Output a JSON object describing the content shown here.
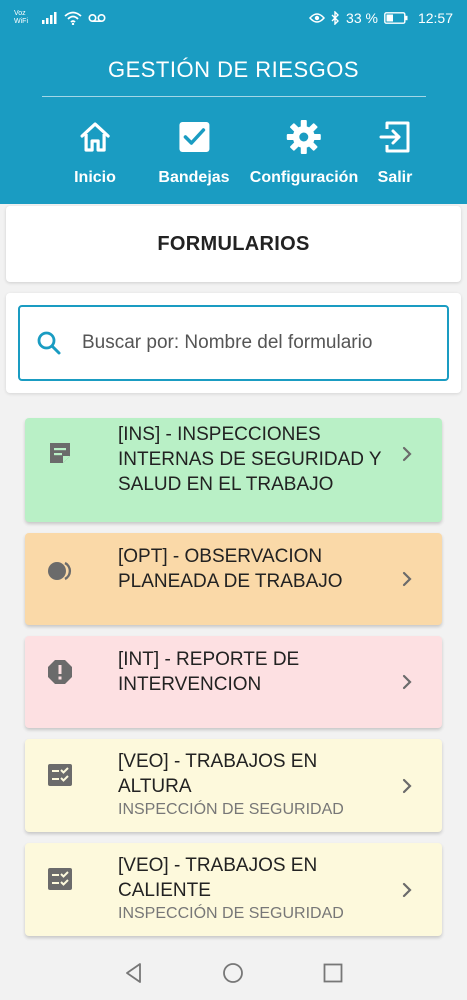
{
  "status_bar": {
    "carrier_line1": "Voz",
    "carrier_line2": "WiFi",
    "battery": "33 %",
    "time": "12:57"
  },
  "header": {
    "title": "GESTIÓN DE RIESGOS",
    "nav": [
      {
        "label": "Inicio",
        "icon": "home-icon"
      },
      {
        "label": "Bandejas",
        "icon": "checkbox-icon"
      },
      {
        "label": "Configuración",
        "icon": "gear-icon"
      },
      {
        "label": "Salir",
        "icon": "logout-icon"
      }
    ]
  },
  "section": {
    "title": "FORMULARIOS"
  },
  "search": {
    "placeholder": "Buscar por: Nombre del formulario"
  },
  "forms": [
    {
      "title": "[INS] - INSPECCIONES INTERNAS DE SEGURIDAD Y SALUD EN EL TRABAJO",
      "subtitle": "",
      "icon": "note-icon",
      "color": "#b9f0c6"
    },
    {
      "title": "[OPT] - OBSERVACION PLANEADA DE TRABAJO",
      "subtitle": "",
      "icon": "toggle-icon",
      "color": "#fad9a8"
    },
    {
      "title": "[INT] - REPORTE DE INTERVENCION",
      "subtitle": "",
      "icon": "alert-octagon-icon",
      "color": "#fde0e2"
    },
    {
      "title": "[VEO] -  TRABAJOS EN ALTURA",
      "subtitle": "INSPECCIÓN DE SEGURIDAD",
      "icon": "checklist-icon",
      "color": "#fdf9dc"
    },
    {
      "title": "[VEO] -  TRABAJOS EN CALIENTE",
      "subtitle": "INSPECCIÓN DE SEGURIDAD",
      "icon": "checklist-icon",
      "color": "#fdf9dc"
    }
  ],
  "colors": {
    "primary": "#1a9cc2",
    "icon_gray": "#6b6b6b"
  }
}
